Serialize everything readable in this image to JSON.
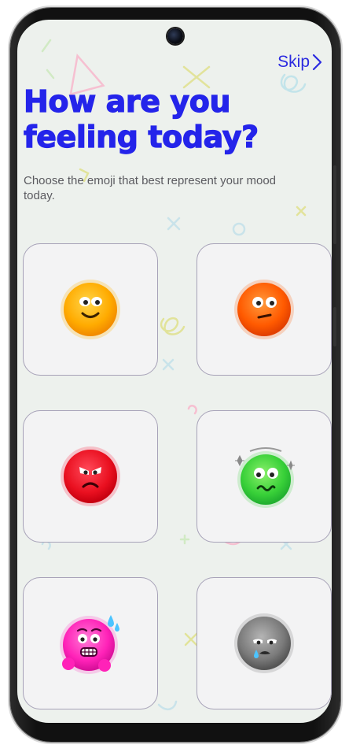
{
  "header": {
    "skip_label": "Skip",
    "title_line1": "How are you",
    "title_line2": "feeling today?",
    "subtitle": "Choose the emoji that best represent your mood today."
  },
  "moods": [
    {
      "icon": "happy-face-icon",
      "color": "#ffa000"
    },
    {
      "icon": "uneasy-face-icon",
      "color": "#ff5a00"
    },
    {
      "icon": "angry-face-icon",
      "color": "#ee1020"
    },
    {
      "icon": "dizzy-face-icon",
      "color": "#38d038"
    },
    {
      "icon": "anxious-sweat-face-icon",
      "color": "#ff2ab8"
    },
    {
      "icon": "sad-tear-face-icon",
      "color": "#6e6e6e"
    }
  ],
  "colors": {
    "accent": "#2424ea",
    "background": "#edf1ed",
    "card_border": "#a7a2b8"
  }
}
